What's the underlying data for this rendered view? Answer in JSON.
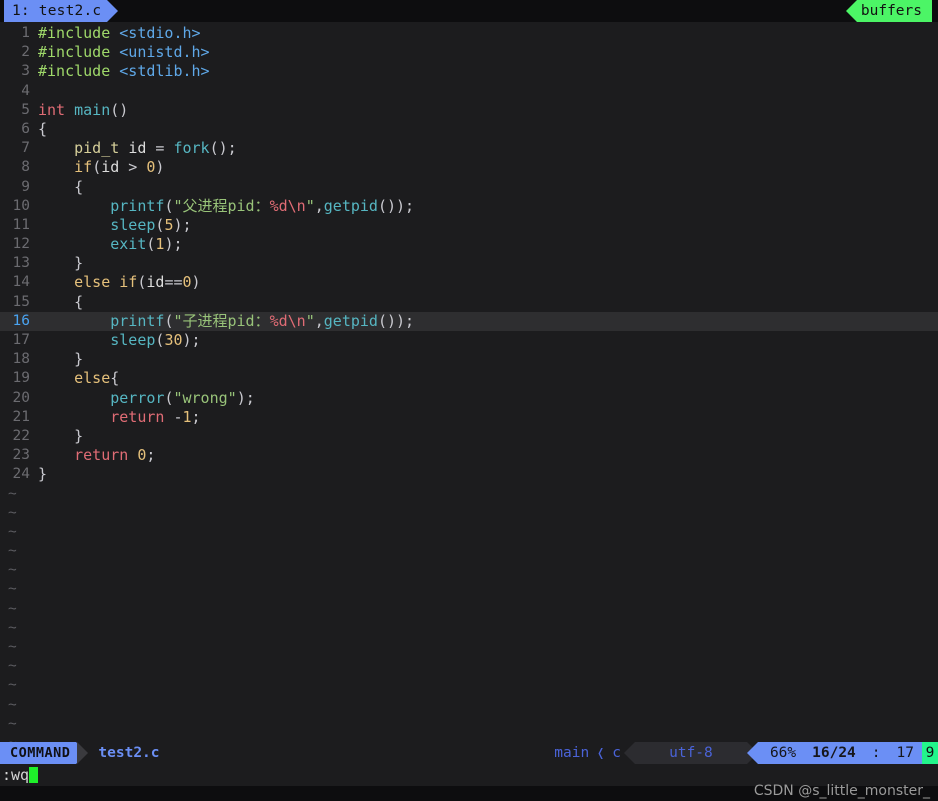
{
  "tabline": {
    "tab_label": "1: test2.c",
    "buffers_label": "buffers"
  },
  "editor": {
    "lines": [
      {
        "n": "1",
        "tokens": [
          {
            "t": "pre",
            "v": "#include"
          },
          {
            "t": "plain",
            "v": " "
          },
          {
            "t": "hdr",
            "v": "<stdio.h>"
          }
        ]
      },
      {
        "n": "2",
        "tokens": [
          {
            "t": "pre",
            "v": "#include"
          },
          {
            "t": "plain",
            "v": " "
          },
          {
            "t": "hdr",
            "v": "<unistd.h>"
          }
        ]
      },
      {
        "n": "3",
        "tokens": [
          {
            "t": "pre",
            "v": "#include"
          },
          {
            "t": "plain",
            "v": " "
          },
          {
            "t": "hdr",
            "v": "<stdlib.h>"
          }
        ]
      },
      {
        "n": "4",
        "tokens": []
      },
      {
        "n": "5",
        "tokens": [
          {
            "t": "type",
            "v": "int"
          },
          {
            "t": "plain",
            "v": " "
          },
          {
            "t": "fn",
            "v": "main"
          },
          {
            "t": "punc",
            "v": "()"
          }
        ]
      },
      {
        "n": "6",
        "tokens": [
          {
            "t": "punc",
            "v": "{"
          }
        ]
      },
      {
        "n": "7",
        "tokens": [
          {
            "t": "plain",
            "v": "    "
          },
          {
            "t": "vtype",
            "v": "pid_t"
          },
          {
            "t": "plain",
            "v": " "
          },
          {
            "t": "var",
            "v": "id"
          },
          {
            "t": "punc",
            "v": " = "
          },
          {
            "t": "fn",
            "v": "fork"
          },
          {
            "t": "punc",
            "v": "();"
          }
        ]
      },
      {
        "n": "8",
        "tokens": [
          {
            "t": "plain",
            "v": "    "
          },
          {
            "t": "kw",
            "v": "if"
          },
          {
            "t": "punc",
            "v": "("
          },
          {
            "t": "var",
            "v": "id"
          },
          {
            "t": "punc",
            "v": " > "
          },
          {
            "t": "num",
            "v": "0"
          },
          {
            "t": "punc",
            "v": ")"
          }
        ]
      },
      {
        "n": "9",
        "tokens": [
          {
            "t": "plain",
            "v": "    "
          },
          {
            "t": "punc",
            "v": "{"
          }
        ]
      },
      {
        "n": "10",
        "tokens": [
          {
            "t": "plain",
            "v": "        "
          },
          {
            "t": "fn",
            "v": "printf"
          },
          {
            "t": "punc",
            "v": "("
          },
          {
            "t": "str",
            "v": "\"父进程pid："
          },
          {
            "t": "esc",
            "v": "%d\\n"
          },
          {
            "t": "str",
            "v": "\""
          },
          {
            "t": "punc",
            "v": ","
          },
          {
            "t": "fn",
            "v": "getpid"
          },
          {
            "t": "punc",
            "v": "());"
          }
        ]
      },
      {
        "n": "11",
        "tokens": [
          {
            "t": "plain",
            "v": "        "
          },
          {
            "t": "fn",
            "v": "sleep"
          },
          {
            "t": "punc",
            "v": "("
          },
          {
            "t": "num",
            "v": "5"
          },
          {
            "t": "punc",
            "v": ");"
          }
        ]
      },
      {
        "n": "12",
        "tokens": [
          {
            "t": "plain",
            "v": "        "
          },
          {
            "t": "fn",
            "v": "exit"
          },
          {
            "t": "punc",
            "v": "("
          },
          {
            "t": "num",
            "v": "1"
          },
          {
            "t": "punc",
            "v": ");"
          }
        ]
      },
      {
        "n": "13",
        "tokens": [
          {
            "t": "plain",
            "v": "    "
          },
          {
            "t": "punc",
            "v": "}"
          }
        ]
      },
      {
        "n": "14",
        "tokens": [
          {
            "t": "plain",
            "v": "    "
          },
          {
            "t": "kw",
            "v": "else if"
          },
          {
            "t": "punc",
            "v": "("
          },
          {
            "t": "var",
            "v": "id"
          },
          {
            "t": "punc",
            "v": "=="
          },
          {
            "t": "num",
            "v": "0"
          },
          {
            "t": "punc",
            "v": ")"
          }
        ]
      },
      {
        "n": "15",
        "tokens": [
          {
            "t": "plain",
            "v": "    "
          },
          {
            "t": "punc",
            "v": "{"
          }
        ]
      },
      {
        "n": "16",
        "cursorline": true,
        "tokens": [
          {
            "t": "plain",
            "v": "        "
          },
          {
            "t": "fn",
            "v": "printf"
          },
          {
            "t": "punc",
            "v": "("
          },
          {
            "t": "str",
            "v": "\"子进程pid："
          },
          {
            "t": "esc",
            "v": "%d\\n"
          },
          {
            "t": "str",
            "v": "\""
          },
          {
            "t": "punc",
            "v": ","
          },
          {
            "t": "fn",
            "v": "getpid"
          },
          {
            "t": "punc",
            "v": "());"
          }
        ]
      },
      {
        "n": "17",
        "tokens": [
          {
            "t": "plain",
            "v": "        "
          },
          {
            "t": "fn",
            "v": "sleep"
          },
          {
            "t": "punc",
            "v": "("
          },
          {
            "t": "num",
            "v": "30"
          },
          {
            "t": "punc",
            "v": ");"
          }
        ]
      },
      {
        "n": "18",
        "tokens": [
          {
            "t": "plain",
            "v": "    "
          },
          {
            "t": "punc",
            "v": "}"
          }
        ]
      },
      {
        "n": "19",
        "tokens": [
          {
            "t": "plain",
            "v": "    "
          },
          {
            "t": "kw",
            "v": "else"
          },
          {
            "t": "punc",
            "v": "{"
          }
        ]
      },
      {
        "n": "20",
        "tokens": [
          {
            "t": "plain",
            "v": "        "
          },
          {
            "t": "fn",
            "v": "perror"
          },
          {
            "t": "punc",
            "v": "("
          },
          {
            "t": "str",
            "v": "\"wrong\""
          },
          {
            "t": "punc",
            "v": ");"
          }
        ]
      },
      {
        "n": "21",
        "tokens": [
          {
            "t": "plain",
            "v": "        "
          },
          {
            "t": "kwr",
            "v": "return"
          },
          {
            "t": "punc",
            "v": " -"
          },
          {
            "t": "num",
            "v": "1"
          },
          {
            "t": "punc",
            "v": ";"
          }
        ]
      },
      {
        "n": "22",
        "tokens": [
          {
            "t": "plain",
            "v": "    "
          },
          {
            "t": "punc",
            "v": "}"
          }
        ]
      },
      {
        "n": "23",
        "tokens": [
          {
            "t": "plain",
            "v": "    "
          },
          {
            "t": "kwr",
            "v": "return"
          },
          {
            "t": "plain",
            "v": " "
          },
          {
            "t": "num",
            "v": "0"
          },
          {
            "t": "punc",
            "v": ";"
          }
        ]
      },
      {
        "n": "24",
        "tokens": [
          {
            "t": "punc",
            "v": "}"
          }
        ]
      }
    ],
    "empty_marker": "~",
    "empty_line_count": 15
  },
  "statusline": {
    "mode": "COMMAND",
    "filename": "test2.c",
    "branch": "main",
    "branch_separator": "❬",
    "filetype": "c",
    "encoding": "utf-8",
    "percent": "66%",
    "line_of_total": "16/24",
    "colon": ":",
    "column": "17",
    "scroll_flag": "9"
  },
  "cmdline": {
    "text": ":wq"
  },
  "watermark": {
    "text": "CSDN @s_little_monster_"
  },
  "colors": {
    "accent_blue": "#6b8ff5",
    "accent_green": "#4cf566",
    "cursor_green": "#1ef02a",
    "background": "#1c1c1e",
    "cursorline": "#2e2e30"
  }
}
